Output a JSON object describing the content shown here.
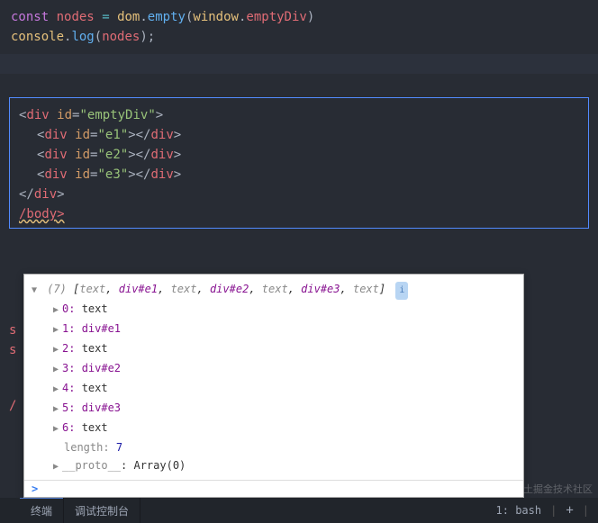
{
  "code_top": {
    "l1": {
      "const": "const",
      "nodes": "nodes",
      "eq": "=",
      "dom": "dom",
      "dot1": ".",
      "empty": "empty",
      "lp": "(",
      "window": "window",
      "dot2": ".",
      "emptyDiv": "emptyDiv",
      "rp": ")"
    },
    "l2": {
      "console": "console",
      "dot": ".",
      "log": "log",
      "lp": "(",
      "nodes": "nodes",
      "rp": ")",
      "semi": ";"
    }
  },
  "html": {
    "open": {
      "lt": "<",
      "tag": "div",
      "sp": " ",
      "attr": "id",
      "eq": "=",
      "val": "\"emptyDiv\"",
      "gt": ">"
    },
    "children": [
      {
        "lt": "<",
        "tag": "div",
        "sp": " ",
        "attr": "id",
        "eq": "=",
        "val": "\"e1\"",
        "gt": ">",
        "clt": "</",
        "ctag": "div",
        "cgt": ">"
      },
      {
        "lt": "<",
        "tag": "div",
        "sp": " ",
        "attr": "id",
        "eq": "=",
        "val": "\"e2\"",
        "gt": ">",
        "clt": "</",
        "ctag": "div",
        "cgt": ">"
      },
      {
        "lt": "<",
        "tag": "div",
        "sp": " ",
        "attr": "id",
        "eq": "=",
        "val": "\"e3\"",
        "gt": ">",
        "clt": "</",
        "ctag": "div",
        "cgt": ">"
      }
    ],
    "close": {
      "lt": "</",
      "tag": "div",
      "gt": ">"
    },
    "body_close": "/body>"
  },
  "left_markers": {
    "s1": "s",
    "s2": "s",
    "slash": "/"
  },
  "console": {
    "summary": {
      "count": "(7)",
      "open": " [",
      "items": [
        {
          "t": "text",
          "c": ","
        },
        {
          "t": "div#e1",
          "c": ","
        },
        {
          "t": "text",
          "c": ","
        },
        {
          "t": "div#e2",
          "c": ","
        },
        {
          "t": "text",
          "c": ","
        },
        {
          "t": "div#e3",
          "c": ","
        },
        {
          "t": "text",
          "c": ""
        }
      ],
      "close": "]",
      "info": "i"
    },
    "entries": [
      {
        "idx": "0:",
        "val": "text",
        "kind": "text"
      },
      {
        "idx": "1:",
        "val": "div#e1",
        "kind": "el"
      },
      {
        "idx": "2:",
        "val": "text",
        "kind": "text"
      },
      {
        "idx": "3:",
        "val": "div#e2",
        "kind": "el"
      },
      {
        "idx": "4:",
        "val": "text",
        "kind": "text"
      },
      {
        "idx": "5:",
        "val": "div#e3",
        "kind": "el"
      },
      {
        "idx": "6:",
        "val": "text",
        "kind": "text"
      }
    ],
    "length": {
      "label": "length:",
      "val": "7"
    },
    "proto": {
      "key": "__proto__",
      "colon": ": ",
      "val": "Array(0)"
    },
    "prompt": ">"
  },
  "bottom": {
    "tab1": "终端",
    "tab2": "调试控制台",
    "right_label": "1: bash",
    "plus": "+"
  },
  "watermark": "@稀土掘金技术社区"
}
